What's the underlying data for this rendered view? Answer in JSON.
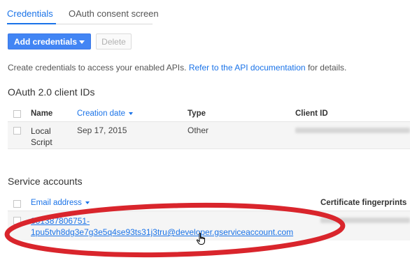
{
  "tabs": [
    {
      "label": "Credentials",
      "active": true
    },
    {
      "label": "OAuth consent screen",
      "active": false
    }
  ],
  "toolbar": {
    "add_label": "Add credentials",
    "delete_label": "Delete"
  },
  "intro": {
    "prefix": "Create credentials to access your enabled APIs.",
    "link": "Refer to the API documentation",
    "suffix": "for details."
  },
  "oauth": {
    "title": "OAuth 2.0 client IDs",
    "columns": [
      "Name",
      "Creation date",
      "Type",
      "Client ID"
    ],
    "sorted_column": "Creation date",
    "rows": [
      {
        "name_line1": "Local",
        "name_line2": "Script",
        "date": "Sep 17, 2015",
        "type": "Other"
      }
    ]
  },
  "service": {
    "title": "Service accounts",
    "columns": [
      "Email address",
      "Certificate fingerprints"
    ],
    "rows": [
      {
        "email_line1": "381387806751-",
        "email_line2": "1pu5tvh8dg3e7g3e5q4se93ts31j3tru@developer.gserviceaccount.com"
      }
    ]
  },
  "colors": {
    "accent": "#1a73e8",
    "primary_button": "#4285f4",
    "annotation": "#d9252c"
  }
}
